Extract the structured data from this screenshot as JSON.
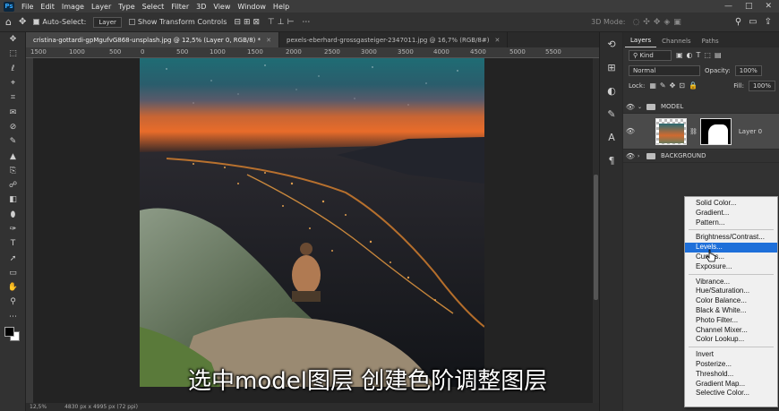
{
  "menubar": {
    "logo": "Ps",
    "items": [
      "File",
      "Edit",
      "Image",
      "Layer",
      "Type",
      "Select",
      "Filter",
      "3D",
      "View",
      "Window",
      "Help"
    ],
    "window_controls": [
      "—",
      "□",
      "✕"
    ]
  },
  "options_bar": {
    "auto_select_label": "Auto-Select:",
    "auto_select_target": "Layer",
    "show_transform_label": "Show Transform Controls",
    "mode_3d_label": "3D Mode:"
  },
  "tools": [
    "✥",
    "⬚",
    "ℓ",
    "⌖",
    "⌗",
    "✉",
    "⊘",
    "✎",
    "▲",
    "⎘",
    "☍",
    "◧",
    "⬮",
    "✑",
    "T",
    "➚",
    "▭",
    "✋",
    "⚲",
    "⋯"
  ],
  "tabs": [
    {
      "label": "cristina-gottardi-gpMgufvG868-unsplash.jpg @ 12,5% (Layer 0, RGB/8) *",
      "active": true
    },
    {
      "label": "pexels-eberhard-grossgasteiger-2347011.jpg @ 16,7% (RGB/8#)",
      "active": false
    }
  ],
  "ruler_labels": [
    "1500",
    "1000",
    "500",
    "0",
    "500",
    "1000",
    "1500",
    "2000",
    "2500",
    "3000",
    "3500",
    "4000",
    "4500",
    "5000",
    "5500"
  ],
  "status_bar": {
    "zoom": "12,5%",
    "doc_size": "4830 px x 4995 px (72 ppi)"
  },
  "layers_panel": {
    "tabs": [
      "Layers",
      "Channels",
      "Paths"
    ],
    "kind_filter": "Kind",
    "blend_mode": "Normal",
    "opacity_label": "Opacity:",
    "opacity_value": "100%",
    "lock_label": "Lock:",
    "fill_label": "Fill:",
    "fill_value": "100%",
    "layers": [
      {
        "name": "MODEL",
        "type": "group"
      },
      {
        "name": "Layer 0",
        "type": "pixel"
      },
      {
        "name": "BACKGROUND",
        "type": "group"
      }
    ]
  },
  "adjustment_menu": {
    "groups": [
      [
        "Solid Color...",
        "Gradient...",
        "Pattern..."
      ],
      [
        "Brightness/Contrast...",
        "Levels...",
        "Curves...",
        "Exposure..."
      ],
      [
        "Vibrance...",
        "Hue/Saturation...",
        "Color Balance...",
        "Black & White...",
        "Photo Filter...",
        "Channel Mixer...",
        "Color Lookup..."
      ],
      [
        "Invert",
        "Posterize...",
        "Threshold...",
        "Gradient Map...",
        "Selective Color..."
      ]
    ],
    "highlighted": "Levels..."
  },
  "subtitle": "选中model图层 创建色阶调整图层",
  "colors": {
    "highlight": "#1e6fd9",
    "sky_top": "#1f5f6a",
    "horizon": "#e8672a"
  }
}
